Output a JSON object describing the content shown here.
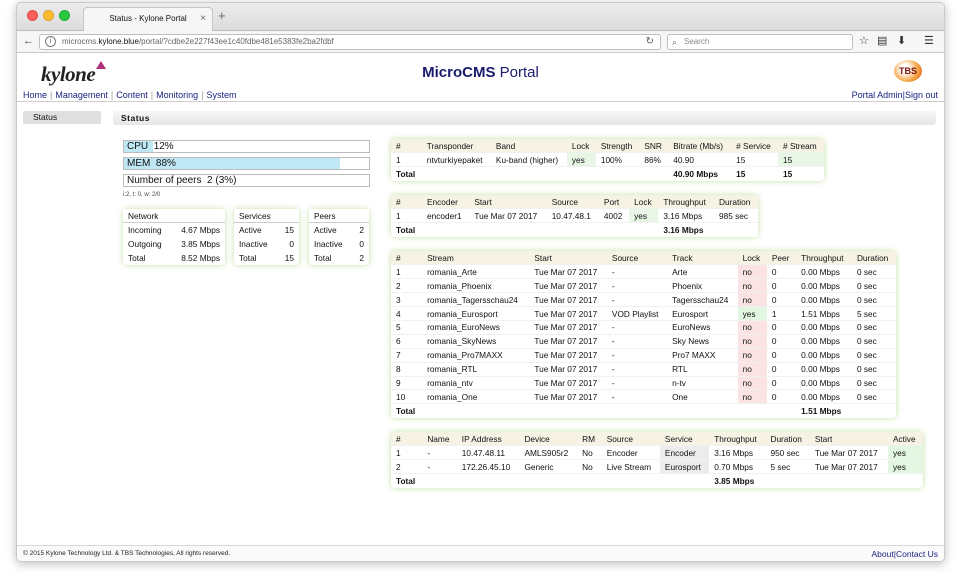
{
  "browser": {
    "tab_title": "Status - Kylone Portal",
    "tab_close": "×",
    "new_tab": "+",
    "url_prefix": "microcms.",
    "url_domain": "kylone.blue",
    "url_path": "/portal/?cdbe2e227f43ee1c40fdbe481e5383fe2ba2fdbf",
    "search_placeholder": "Search"
  },
  "header": {
    "logo": "kylone",
    "title_bold": "MicroCMS",
    "title_rest": " Portal",
    "partner_logo": "TBS"
  },
  "menu": {
    "items": [
      "Home",
      "Management",
      "Content",
      "Monitoring",
      "System"
    ],
    "right_items": [
      "Portal Admin",
      "Sign out"
    ]
  },
  "sidebar": {
    "items": [
      "Status"
    ]
  },
  "section_title": "Status",
  "meters": {
    "cpu": {
      "label": "CPU",
      "value": "12%",
      "fraction": 0.12
    },
    "mem": {
      "label": "MEM",
      "value": "88%",
      "fraction": 0.88
    },
    "peers": {
      "label": "Number of peers",
      "value": "2 (3%)",
      "fraction": 0.0
    },
    "note": "i:2, t: 0, w: 2/0"
  },
  "network": {
    "header": "Network",
    "rows": [
      [
        "Incoming",
        "4.67 Mbps"
      ],
      [
        "Outgoing",
        "3.85 Mbps"
      ],
      [
        "Total",
        "8.52 Mbps"
      ]
    ]
  },
  "services": {
    "header": "Services",
    "rows": [
      [
        "Active",
        "15"
      ],
      [
        "Inactive",
        "0"
      ],
      [
        "Total",
        "15"
      ]
    ]
  },
  "peers": {
    "header": "Peers",
    "rows": [
      [
        "Active",
        "2"
      ],
      [
        "Inactive",
        "0"
      ],
      [
        "Total",
        "2"
      ]
    ]
  },
  "transponder_table": {
    "headers": [
      "#",
      "Transponder",
      "Band",
      "Lock",
      "Strength",
      "SNR",
      "Bitrate (Mb/s)",
      "# Service",
      "# Stream"
    ],
    "rows": [
      [
        "1",
        "ntvturkiyepaket",
        "Ku-band (higher)",
        "yes",
        "100%",
        "86%",
        "40.90",
        "15",
        "15"
      ]
    ],
    "total": [
      "Total",
      "",
      "",
      "",
      "",
      "",
      "40.90 Mbps",
      "15",
      "15"
    ]
  },
  "encoder_table": {
    "headers": [
      "#",
      "Encoder",
      "Start",
      "Source",
      "Port",
      "Lock",
      "Throughput",
      "Duration"
    ],
    "rows": [
      [
        "1",
        "encoder1",
        "Tue Mar 07 2017",
        "10.47.48.1",
        "4002",
        "yes",
        "3.16 Mbps",
        "985 sec"
      ]
    ],
    "total": [
      "Total",
      "",
      "",
      "",
      "",
      "",
      "3.16 Mbps",
      ""
    ]
  },
  "stream_table": {
    "headers": [
      "#",
      "Stream",
      "Start",
      "Source",
      "Track",
      "Lock",
      "Peer",
      "Throughput",
      "Duration"
    ],
    "rows": [
      [
        "1",
        "romania_Arte",
        "Tue Mar 07 2017",
        "-",
        "Arte",
        "no",
        "0",
        "0.00 Mbps",
        "0 sec"
      ],
      [
        "2",
        "romania_Phoenix",
        "Tue Mar 07 2017",
        "-",
        "Phoenix",
        "no",
        "0",
        "0.00 Mbps",
        "0 sec"
      ],
      [
        "3",
        "romania_Tagersschau24",
        "Tue Mar 07 2017",
        "-",
        "Tagersschau24",
        "no",
        "0",
        "0.00 Mbps",
        "0 sec"
      ],
      [
        "4",
        "romania_Eurosport",
        "Tue Mar 07 2017",
        "VOD Playlist",
        "Eurosport",
        "yes",
        "1",
        "1.51 Mbps",
        "5 sec"
      ],
      [
        "5",
        "romania_EuroNews",
        "Tue Mar 07 2017",
        "-",
        "EuroNews",
        "no",
        "0",
        "0.00 Mbps",
        "0 sec"
      ],
      [
        "6",
        "romania_SkyNews",
        "Tue Mar 07 2017",
        "-",
        "Sky News",
        "no",
        "0",
        "0.00 Mbps",
        "0 sec"
      ],
      [
        "7",
        "romania_Pro7MAXX",
        "Tue Mar 07 2017",
        "-",
        "Pro7 MAXX",
        "no",
        "0",
        "0.00 Mbps",
        "0 sec"
      ],
      [
        "8",
        "romania_RTL",
        "Tue Mar 07 2017",
        "-",
        "RTL",
        "no",
        "0",
        "0.00 Mbps",
        "0 sec"
      ],
      [
        "9",
        "romania_ntv",
        "Tue Mar 07 2017",
        "-",
        "n-tv",
        "no",
        "0",
        "0.00 Mbps",
        "0 sec"
      ],
      [
        "10",
        "romania_One",
        "Tue Mar 07 2017",
        "-",
        "One",
        "no",
        "0",
        "0.00 Mbps",
        "0 sec"
      ]
    ],
    "total": [
      "Total",
      "",
      "",
      "",
      "",
      "",
      "",
      "1.51 Mbps",
      ""
    ]
  },
  "peer_table": {
    "headers": [
      "#",
      "Name",
      "IP Address",
      "Device",
      "RM",
      "Source",
      "Service",
      "Throughput",
      "Duration",
      "Start",
      "Active"
    ],
    "rows": [
      [
        "1",
        "-",
        "10.47.48.11",
        "AMLS905r2",
        "No",
        "Encoder",
        "Encoder",
        "3.16 Mbps",
        "950 sec",
        "Tue Mar 07 2017",
        "yes"
      ],
      [
        "2",
        "-",
        "172.26.45.10",
        "Generic",
        "No",
        "Live Stream",
        "Eurosport",
        "0.70 Mbps",
        "5 sec",
        "Tue Mar 07 2017",
        "yes"
      ]
    ],
    "total": [
      "Total",
      "",
      "",
      "",
      "",
      "",
      "",
      "3.85 Mbps",
      "",
      "",
      ""
    ]
  },
  "footer": {
    "copyright": "© 2015 Kylone Technology Ltd. & TBS Technologies, All rights reserved.",
    "links": [
      "About",
      "Contact Us"
    ]
  },
  "colors": {
    "link": "#1a237e",
    "title": "#1a1a6e",
    "meter_fill": "#bfe8f4",
    "panel_glow": "#aad278",
    "lock_no": "#fbe3e3",
    "lock_yes": "#e3f6e1"
  }
}
